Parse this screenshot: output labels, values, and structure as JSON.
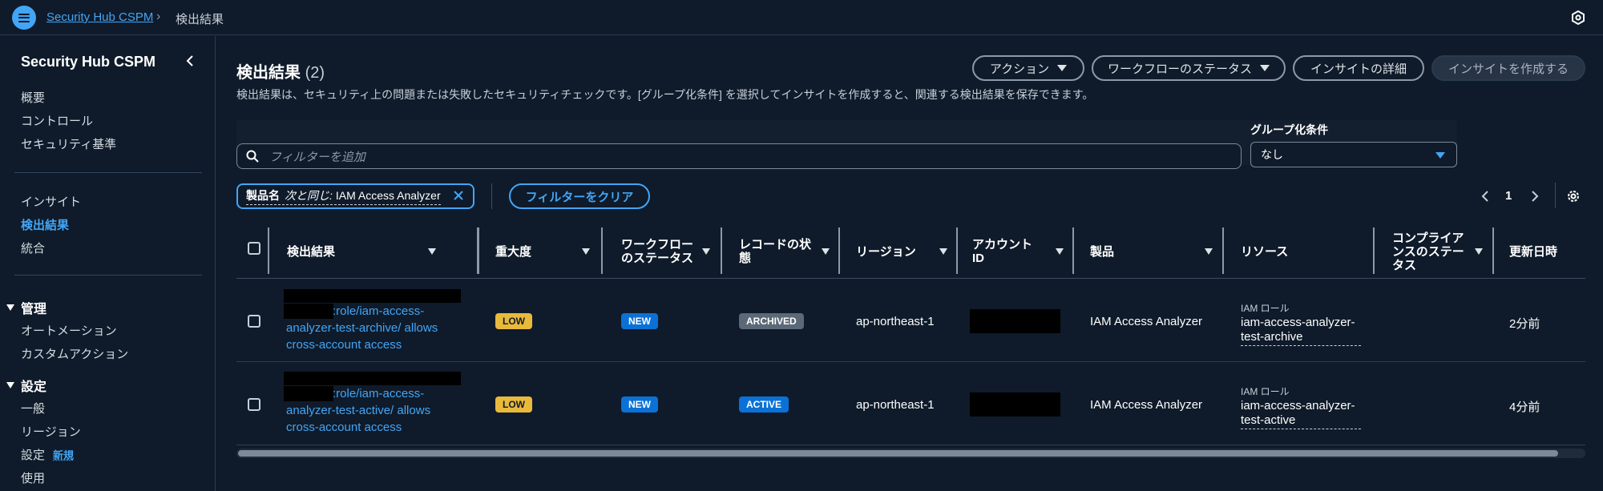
{
  "breadcrumb": {
    "root": "Security Hub CSPM",
    "current": "検出結果"
  },
  "sidebar": {
    "title": "Security Hub CSPM",
    "group1": [
      "概要",
      "コントロール",
      "セキュリティ基準"
    ],
    "group2": [
      "インサイト",
      "検出結果",
      "統合"
    ],
    "section_manage": {
      "label": "管理",
      "items": [
        "オートメーション",
        "カスタムアクション"
      ]
    },
    "section_settings": {
      "label": "設定",
      "items": [
        "一般",
        "リージョン",
        "設定",
        "使用"
      ],
      "new_badge": "新規"
    }
  },
  "header": {
    "title": "検出結果",
    "count": "(2)",
    "description": "検出結果は、セキュリティ上の問題または失敗したセキュリティチェックです。[グループ化条件] を選択してインサイトを作成すると、関連する検出結果を保存できます。",
    "buttons": {
      "actions": "アクション",
      "workflow_status": "ワークフローのステータス",
      "insight_details": "インサイトの詳細",
      "create_insight": "インサイトを作成する"
    }
  },
  "filter": {
    "search_placeholder": "フィルターを追加",
    "group_label": "グループ化条件",
    "group_value": "なし",
    "token": {
      "key": "製品名",
      "operator": "次と同じ:",
      "value": "IAM Access Analyzer"
    },
    "clear_label": "フィルターをクリア"
  },
  "pagination": {
    "page": "1"
  },
  "table": {
    "columns": {
      "finding": "検出結果",
      "severity": "重大度",
      "workflow": [
        "ワークフロー",
        "のステータス"
      ],
      "record_state": [
        "レコードの状",
        "態"
      ],
      "region": "リージョン",
      "account": [
        "アカウント",
        "ID"
      ],
      "product": "製品",
      "resource": "リソース",
      "compliance": [
        "コンプライア",
        "ンスのステー",
        "タス"
      ],
      "updated": "更新日時"
    },
    "rows": [
      {
        "finding": [
          ":role/iam-access-",
          "analyzer-test-archive/ allows",
          "cross-account access"
        ],
        "severity": "LOW",
        "workflow": "NEW",
        "record_state": "ARCHIVED",
        "region": "ap-northeast-1",
        "product": "IAM Access Analyzer",
        "resource_type": "IAM ロール",
        "resource_name": [
          "iam-access-analyzer-",
          "test-archive"
        ],
        "updated": "2分前"
      },
      {
        "finding": [
          ":role/iam-access-",
          "analyzer-test-active/ allows",
          "cross-account access"
        ],
        "severity": "LOW",
        "workflow": "NEW",
        "record_state": "ACTIVE",
        "region": "ap-northeast-1",
        "product": "IAM Access Analyzer",
        "resource_type": "IAM ロール",
        "resource_name": [
          "iam-access-analyzer-",
          "test-active"
        ],
        "updated": "4分前"
      }
    ]
  }
}
